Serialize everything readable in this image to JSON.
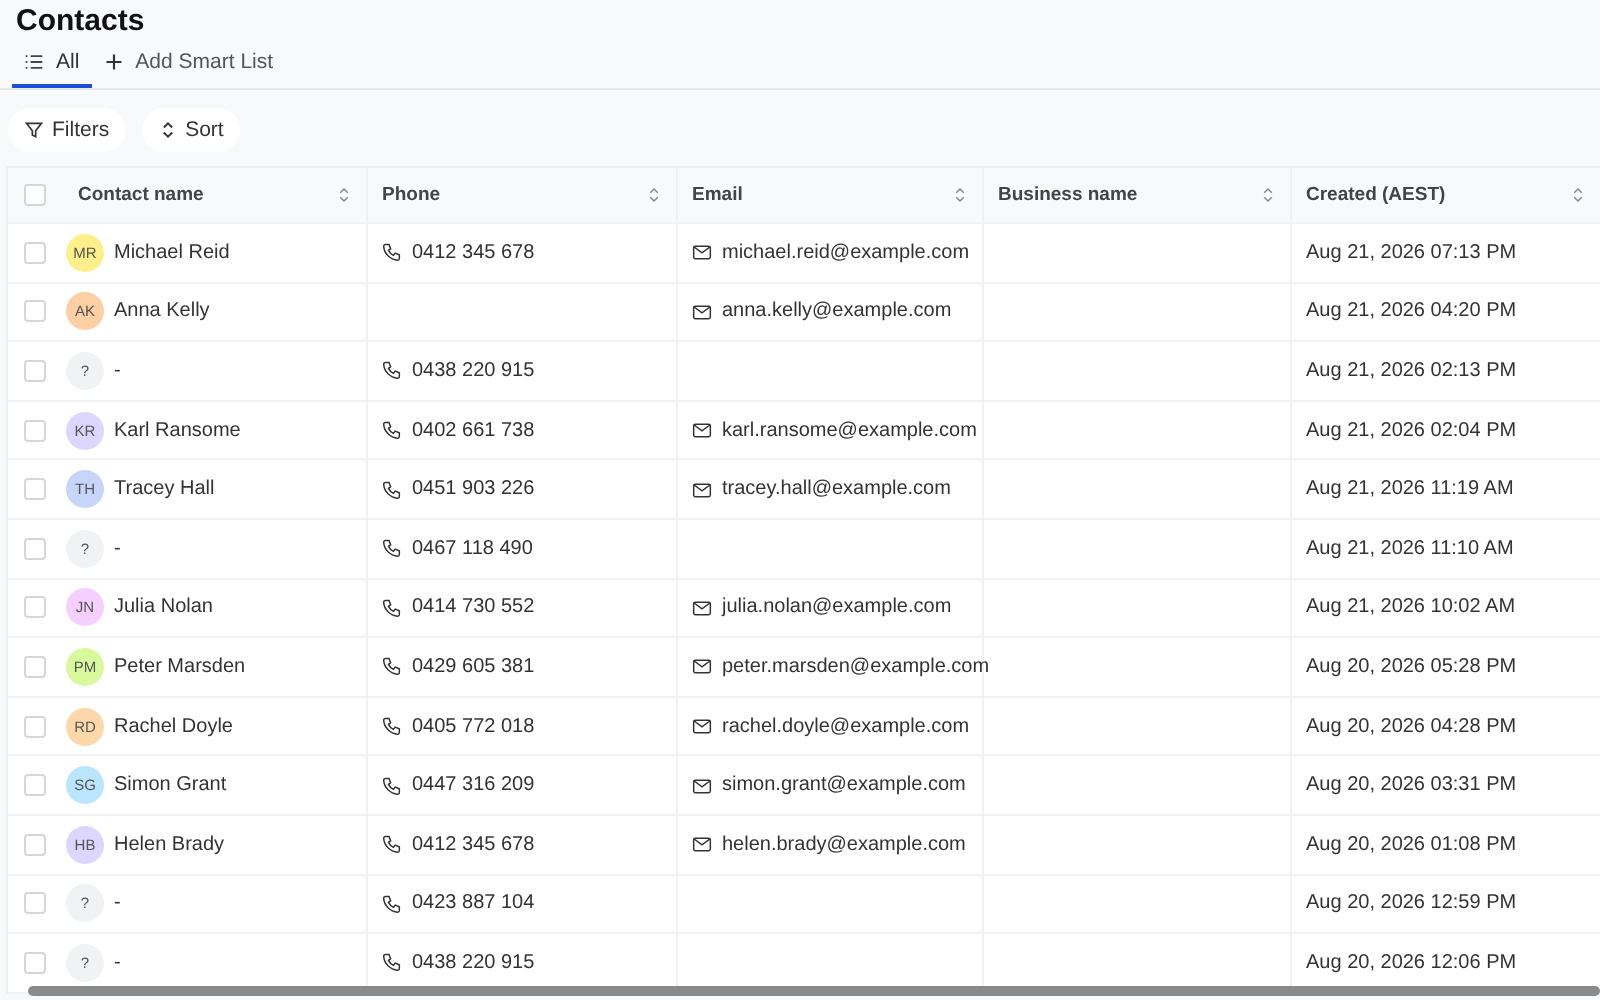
{
  "page": {
    "title": "Contacts"
  },
  "tabs": [
    {
      "label": "All",
      "selected": true,
      "kind": "list"
    },
    {
      "label": "Add Smart List",
      "selected": false,
      "kind": "add"
    }
  ],
  "toolbar": [
    {
      "label": "Filters",
      "kind": "filter"
    },
    {
      "label": "Sort",
      "kind": "sort"
    }
  ],
  "table": {
    "select_all_checked": false,
    "columns": [
      "Contact name",
      "Phone",
      "Email",
      "Business name",
      "Created (AEST)"
    ],
    "rows": [
      {
        "initials": "MR",
        "color": "#fdf08a",
        "name": "Michael Reid",
        "phone": "0412 345 678",
        "email": "michael.reid@example.com",
        "created": "Aug 21, 2026 07:13 PM",
        "checked": false
      },
      {
        "initials": "AK",
        "color": "#fdcfa4",
        "name": "Anna Kelly",
        "phone": "",
        "email": "anna.kelly@example.com",
        "created": "Aug 21, 2026 04:20 PM",
        "checked": false
      },
      {
        "initials": "?",
        "color": "#f1f2f4",
        "name": "-",
        "phone": "0438 220 915",
        "email": "",
        "created": "Aug 21, 2026 02:13 PM",
        "checked": false
      },
      {
        "initials": "KR",
        "color": "#ddd6fe",
        "name": "Karl Ransome",
        "phone": "0402 661 738",
        "email": "karl.ransome@example.com",
        "created": "Aug 21, 2026 02:04 PM",
        "checked": false
      },
      {
        "initials": "TH",
        "color": "#c7d5fb",
        "name": "Tracey Hall",
        "phone": "0451 903 226",
        "email": "tracey.hall@example.com",
        "created": "Aug 21, 2026 11:19 AM",
        "checked": false
      },
      {
        "initials": "?",
        "color": "#f1f2f4",
        "name": "-",
        "phone": "0467 118 490",
        "email": "",
        "created": "Aug 21, 2026 11:10 AM",
        "checked": false
      },
      {
        "initials": "JN",
        "color": "#f5d0fe",
        "name": "Julia Nolan",
        "phone": "0414 730 552",
        "email": "julia.nolan@example.com",
        "created": "Aug 21, 2026 10:02 AM",
        "checked": false
      },
      {
        "initials": "PM",
        "color": "#d9f99d",
        "name": "Peter Marsden",
        "phone": "0429 605 381",
        "email": "peter.marsden@example.com",
        "created": "Aug 20, 2026 05:28 PM",
        "checked": false
      },
      {
        "initials": "RD",
        "color": "#fed7aa",
        "name": "Rachel Doyle",
        "phone": "0405 772 018",
        "email": "rachel.doyle@example.com",
        "created": "Aug 20, 2026 04:28 PM",
        "checked": false
      },
      {
        "initials": "SG",
        "color": "#bae6fd",
        "name": "Simon Grant",
        "phone": "0447 316 209",
        "email": "simon.grant@example.com",
        "created": "Aug 20, 2026 03:31 PM",
        "checked": false
      },
      {
        "initials": "HB",
        "color": "#ddd6fe",
        "name": "Helen Brady",
        "phone": "0412 345 678",
        "email": "helen.brady@example.com",
        "created": "Aug 20, 2026 01:08 PM",
        "checked": false
      },
      {
        "initials": "?",
        "color": "#f1f2f4",
        "name": "-",
        "phone": "0423 887 104",
        "email": "",
        "created": "Aug 20, 2026 12:59 PM",
        "checked": false
      },
      {
        "initials": "?",
        "color": "#f1f2f4",
        "name": "-",
        "phone": "0438 220 915",
        "email": "",
        "created": "Aug 20, 2026 12:06 PM",
        "checked": false
      }
    ]
  }
}
